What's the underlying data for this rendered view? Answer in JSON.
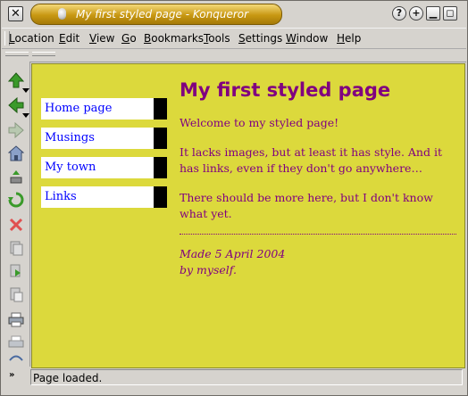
{
  "window": {
    "title": "My first styled page - Konqueror",
    "close_glyph": "✕",
    "help_glyph": "?",
    "maximize_glyph": "+",
    "minimize_glyph": "▁",
    "restore_glyph": "◻"
  },
  "menubar": {
    "items": [
      {
        "underline": "L",
        "rest": "ocation"
      },
      {
        "underline": "E",
        "rest": "dit"
      },
      {
        "underline": "V",
        "rest": "iew"
      },
      {
        "underline": "G",
        "rest": "o"
      },
      {
        "underline": "B",
        "rest": "ookmarks"
      },
      {
        "underline": "T",
        "rest": "ools"
      },
      {
        "underline": "S",
        "rest": "ettings"
      },
      {
        "underline": "W",
        "rest": "indow"
      },
      {
        "underline": "H",
        "rest": "elp"
      }
    ]
  },
  "sidebar": {
    "icons": [
      "up-arrow",
      "back-arrow",
      "forward-arrow",
      "home",
      "stop-disabled",
      "reload",
      "stop",
      "copy",
      "paste",
      "print",
      "print-preview",
      "find"
    ],
    "more_glyph": "»"
  },
  "page": {
    "nav": [
      "Home page",
      "Musings",
      "My town",
      "Links"
    ],
    "title": "My first styled page",
    "paragraphs": [
      "Welcome to my styled page!",
      "It lacks images, but at least it has style. And it has links, even if they don't go anywhere…",
      "There should be more here, but I don't know what yet."
    ],
    "address_line1": "Made 5 April 2004",
    "address_line2": "by myself."
  },
  "status": {
    "text": "Page loaded."
  },
  "colors": {
    "background": "#dcd93c",
    "text": "#800080",
    "link": "#0000ff",
    "titlebar": "#c89812"
  }
}
